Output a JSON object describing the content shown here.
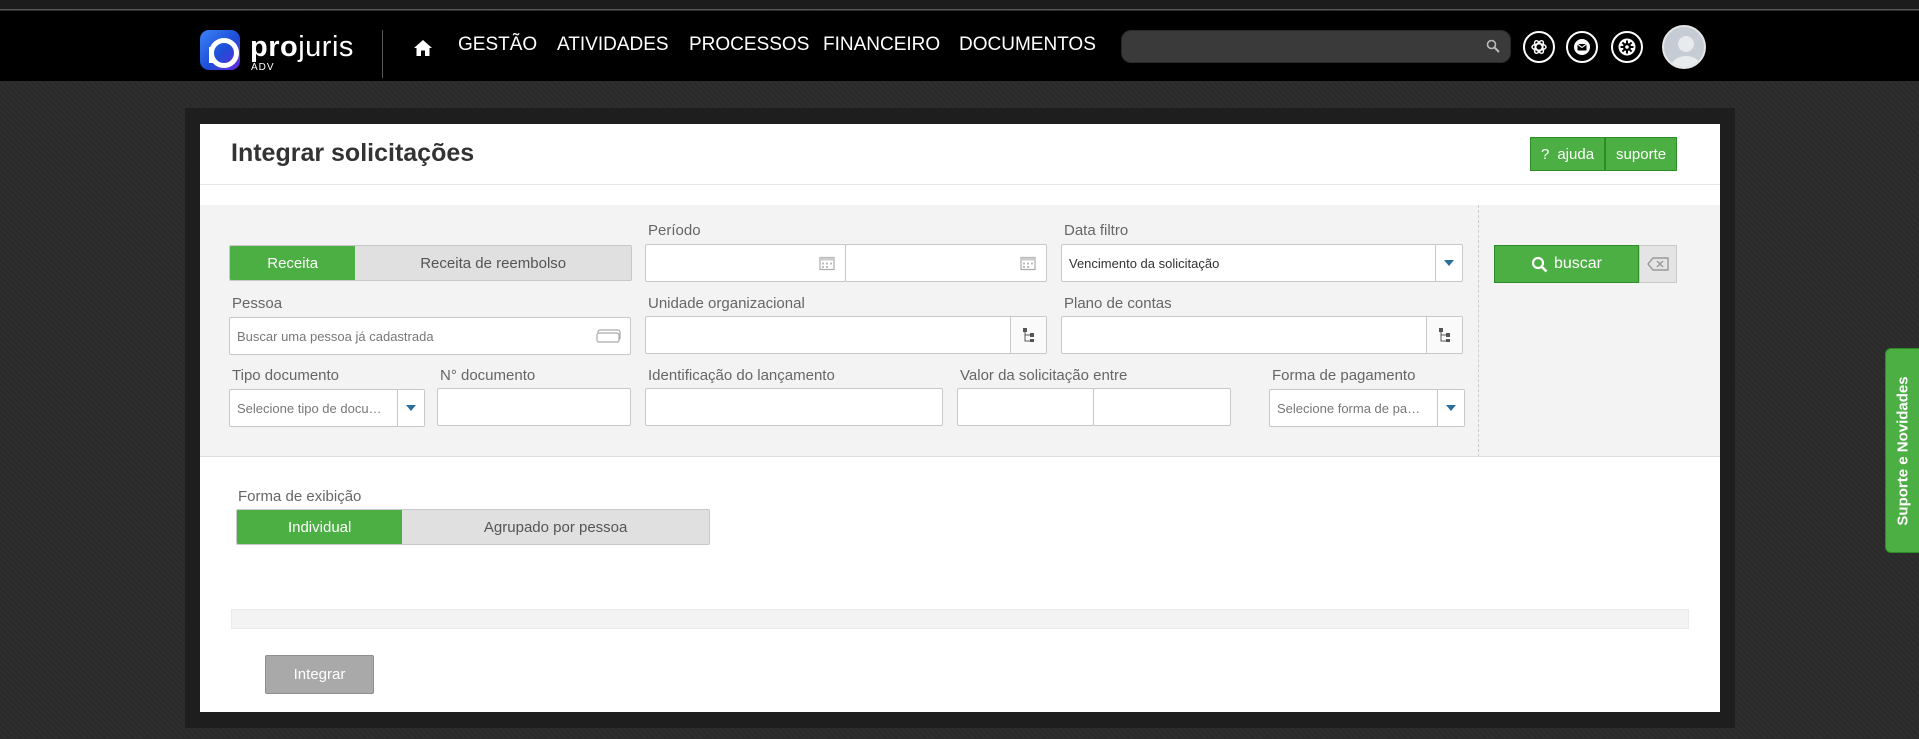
{
  "app": {
    "brand": {
      "name_bold": "pro",
      "name_thin": "juris",
      "sub": "ADV"
    },
    "nav": {
      "home_icon": "home-icon",
      "items": [
        {
          "label": "GESTÃO"
        },
        {
          "label": "ATIVIDADES"
        },
        {
          "label": "PROCESSOS"
        },
        {
          "label": "FINANCEIRO"
        },
        {
          "label": "DOCUMENTOS"
        }
      ],
      "search": {
        "value": "",
        "placeholder": "",
        "icon": "search-icon"
      },
      "icons": [
        "openai-icon",
        "mail-icon",
        "settings-icon"
      ],
      "avatar": "avatar"
    }
  },
  "page": {
    "title": "Integrar solicitações",
    "help_label": "ajuda",
    "help_glyph": "?",
    "support_label": "suporte"
  },
  "filters": {
    "tipo_toggle": {
      "options": [
        "Receita",
        "Receita de reembolso"
      ],
      "selected": "Receita"
    },
    "periodo": {
      "label": "Período",
      "start": "",
      "end": ""
    },
    "data_filtro": {
      "label": "Data filtro",
      "value": "Vencimento da solicitação"
    },
    "pessoa": {
      "label": "Pessoa",
      "placeholder": "Buscar uma pessoa já cadastrada",
      "value": ""
    },
    "unidade": {
      "label": "Unidade organizacional",
      "value": ""
    },
    "plano": {
      "label": "Plano de contas",
      "value": ""
    },
    "tipo_documento": {
      "label": "Tipo documento",
      "value": "Selecione tipo de docu…"
    },
    "num_documento": {
      "label": "N° documento",
      "value": ""
    },
    "identificacao": {
      "label": "Identificação do lançamento",
      "value": ""
    },
    "valor": {
      "label": "Valor da solicitação entre",
      "min": "",
      "max": ""
    },
    "forma_pagamento": {
      "label": "Forma de pagamento",
      "value": "Selecione forma de pa…"
    },
    "search_button": "buscar"
  },
  "display": {
    "label": "Forma de exibição",
    "options": [
      "Individual",
      "Agrupado por pessoa"
    ],
    "selected": "Individual"
  },
  "actions": {
    "integrar": "Integrar"
  },
  "side_tab": {
    "label": "Suporte e Novidades"
  },
  "colors": {
    "accent": "#4caf43",
    "navbar": "#000000",
    "disabled_button": "#a9a9a9"
  }
}
